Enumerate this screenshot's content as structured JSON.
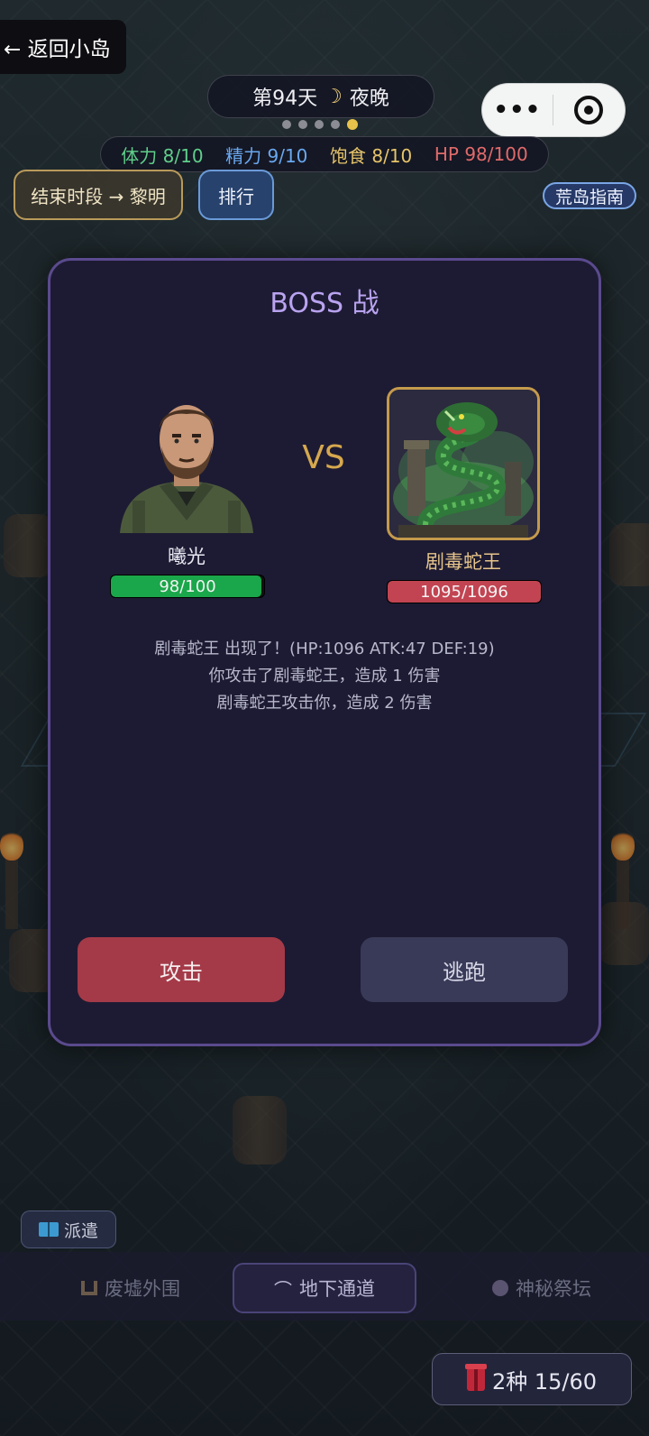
{
  "header": {
    "back_label": "← 返回小岛",
    "day_label": "第94天",
    "period_icon": "moon-icon",
    "period_label": "夜晚",
    "period_dots": 5,
    "active_dot": 5
  },
  "capsule": {
    "more_icon": "more-dots-icon",
    "close_icon": "target-circle-icon"
  },
  "stats": {
    "stamina": "体力 8/10",
    "energy": "精力 9/10",
    "satiety": "饱食 8/10",
    "hp": "HP 98/100"
  },
  "actions": {
    "end_period": "结束时段 → 黎明",
    "ranking": "排行",
    "guide": "荒岛指南"
  },
  "boss_battle": {
    "title": "BOSS 战",
    "vs": "VS",
    "player": {
      "name": "曦光",
      "hp_text": "98/100",
      "hp_current": 98,
      "hp_max": 100
    },
    "boss": {
      "name": "剧毒蛇王",
      "hp_text": "1095/1096",
      "hp_current": 1095,
      "hp_max": 1096
    },
    "log": [
      "剧毒蛇王 出现了！(HP:1096 ATK:47 DEF:19)",
      "你攻击了剧毒蛇王，造成 1 伤害",
      "剧毒蛇王攻击你，造成 2 伤害"
    ],
    "attack_label": "攻击",
    "flee_label": "逃跑"
  },
  "bottom": {
    "dispatch_label": "派遣",
    "nav": [
      {
        "label": "废墟外围",
        "icon": "ruins-icon"
      },
      {
        "label": "地下通道",
        "icon": "tunnel-icon",
        "active": true
      },
      {
        "label": "神秘祭坛",
        "icon": "altar-icon"
      }
    ],
    "bag_label": "2种 15/60"
  },
  "colors": {
    "stamina": "#5fcf8a",
    "energy": "#6aa8f0",
    "satiety": "#e6c46a",
    "hp": "#e06a6a",
    "player_hp_bar": "#1aa64a",
    "boss_hp_bar": "#c24452",
    "attack_button": "#a43a48",
    "flee_button": "#393a58",
    "modal_border": "#5b4a8e",
    "title": "#b9a3f0",
    "vs": "#d6a84e"
  }
}
